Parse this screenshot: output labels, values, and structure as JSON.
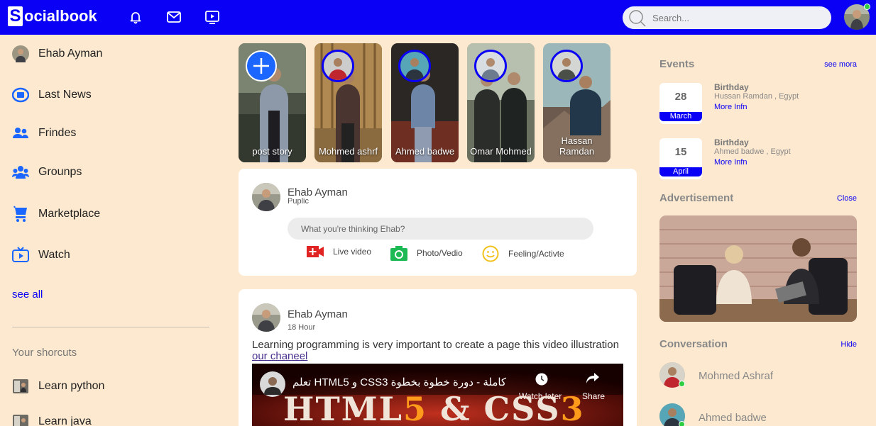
{
  "brand": {
    "logo_letter": "S",
    "logo_rest": "ocialbook"
  },
  "search": {
    "placeholder": "Search..."
  },
  "sidebar": {
    "items": [
      {
        "label": "Ehab Ayman",
        "icon": "profile-avatar"
      },
      {
        "label": "Last News",
        "icon": "news-icon"
      },
      {
        "label": "Frindes",
        "icon": "friends-icon"
      },
      {
        "label": "Grounps",
        "icon": "groups-icon"
      },
      {
        "label": "Marketplace",
        "icon": "marketplace-icon"
      },
      {
        "label": "Watch",
        "icon": "watch-icon"
      }
    ],
    "see_all": "see all",
    "shortcuts_title": "Your shorcuts",
    "shortcuts": [
      {
        "label": "Learn python"
      },
      {
        "label": "Learn java"
      }
    ]
  },
  "stories": [
    {
      "name": "post story"
    },
    {
      "name": "Mohmed ashrf"
    },
    {
      "name": "Ahmed badwe"
    },
    {
      "name": "Omar Mohmed"
    },
    {
      "name": "Hassan Ramdan"
    }
  ],
  "composer": {
    "name": "Ehab Ayman",
    "privacy": "Puplic",
    "placeholder": "What you're thinking Ehab?",
    "actions": [
      "Live video",
      "Photo/Vedio",
      "Feeling/Activte"
    ]
  },
  "post": {
    "name": "Ehab Ayman",
    "time": "18 Hour",
    "text": "Learning programming is very important to create a page this video illustration",
    "link": "our chaneel",
    "video": {
      "title": "تعلم HTML5 و CSS3 كاملة - دورة خطوة بخطوة",
      "watch_later": "Watch later",
      "share": "Share",
      "banner": {
        "part1": "HTML",
        "part2": "5",
        "part3": " & CSS",
        "part4": "3"
      }
    }
  },
  "events": {
    "title": "Events",
    "see_more": "see mora",
    "items": [
      {
        "day": "28",
        "month": "March",
        "title": "Birthday",
        "detail": "Hussan Ramdan , Egypt",
        "link": "More Infn"
      },
      {
        "day": "15",
        "month": "April",
        "title": "Birthday",
        "detail": "Ahmed badwe , Egypt",
        "link": "More Infn"
      }
    ]
  },
  "advertisement": {
    "title": "Advertisement",
    "close": "Close"
  },
  "conversation": {
    "title": "Conversation",
    "hide": "Hide",
    "items": [
      {
        "name": "Mohmed Ashraf",
        "online": true
      },
      {
        "name": "Ahmed badwe",
        "online": true
      }
    ]
  },
  "colors": {
    "brand_blue": "#0a00f5",
    "page_bg": "#fde9cf",
    "online": "#2ecc40"
  }
}
